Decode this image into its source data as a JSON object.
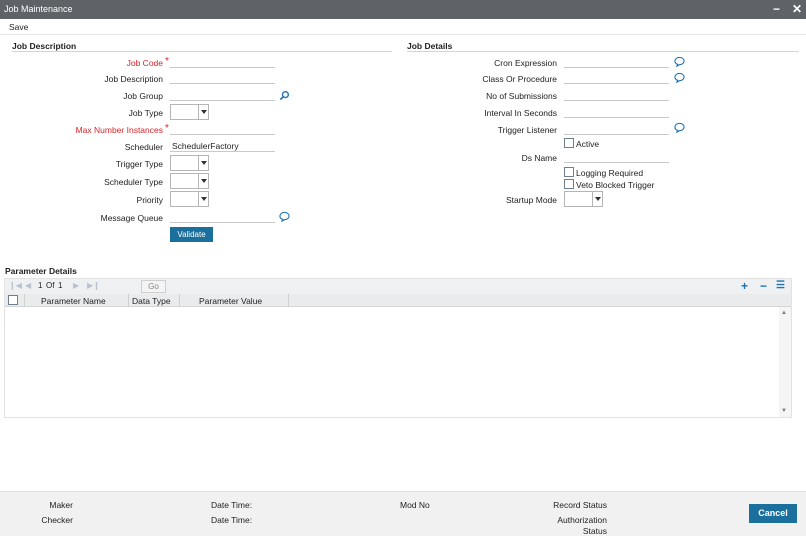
{
  "window": {
    "title": "Job Maintenance",
    "minimize": "−",
    "close": "✕"
  },
  "toolbar": {
    "save_label": "Save"
  },
  "job_description": {
    "heading": "Job Description",
    "job_code": {
      "label": "Job Code",
      "value": ""
    },
    "job_description": {
      "label": "Job Description",
      "value": ""
    },
    "job_group": {
      "label": "Job Group",
      "value": ""
    },
    "job_type": {
      "label": "Job Type",
      "value": ""
    },
    "max_number_instances": {
      "label": "Max Number Instances",
      "value": ""
    },
    "scheduler": {
      "label": "Scheduler",
      "value": "SchedulerFactory"
    },
    "trigger_type": {
      "label": "Trigger Type",
      "value": ""
    },
    "scheduler_type": {
      "label": "Scheduler Type",
      "value": ""
    },
    "priority": {
      "label": "Priority",
      "value": ""
    },
    "message_queue": {
      "label": "Message Queue",
      "value": ""
    },
    "validate_label": "Validate",
    "required_mark": "*"
  },
  "job_details": {
    "heading": "Job Details",
    "cron_expression": {
      "label": "Cron Expression",
      "value": ""
    },
    "class_or_procedure": {
      "label": "Class Or Procedure",
      "value": ""
    },
    "no_of_submissions": {
      "label": "No of Submissions",
      "value": ""
    },
    "interval_in_seconds": {
      "label": "Interval In Seconds",
      "value": ""
    },
    "trigger_listener": {
      "label": "Trigger Listener",
      "value": ""
    },
    "active": {
      "label": "Active",
      "checked": false
    },
    "ds_name": {
      "label": "Ds Name",
      "value": ""
    },
    "logging_required": {
      "label": "Logging Required",
      "checked": false
    },
    "veto_blocked_trigger": {
      "label": "Veto Blocked Trigger",
      "checked": false
    },
    "startup_mode": {
      "label": "Startup Mode",
      "value": ""
    }
  },
  "parameter_details": {
    "heading": "Parameter Details",
    "pagination": {
      "current": "1",
      "of_label": "Of",
      "total": "1",
      "go_label": "Go"
    },
    "columns": [
      "Parameter Name",
      "Data Type",
      "Parameter Value"
    ],
    "rows": [],
    "actions": {
      "add": "+",
      "remove": "−",
      "list": "☰"
    }
  },
  "footer": {
    "maker_label": "Maker",
    "checker_label": "Checker",
    "date_time_label": "Date Time:",
    "mod_no_label": "Mod No",
    "record_status_label": "Record Status",
    "authorization_status_label": "Authorization Status",
    "cancel_label": "Cancel"
  },
  "colors": {
    "titlebar": "#5f6266",
    "primary_button": "#1b6f9c",
    "required": "#d8232a",
    "icon": "#1d73b4"
  }
}
